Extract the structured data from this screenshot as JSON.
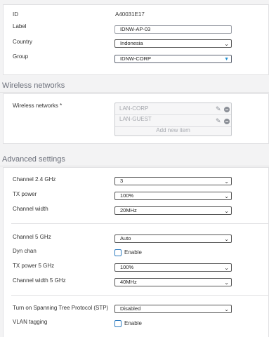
{
  "general": {
    "id_label": "ID",
    "id_value": "A40031E17",
    "label_label": "Label",
    "label_value": "IDNW-AP-03",
    "country_label": "Country",
    "country_value": "Indonesia",
    "group_label": "Group",
    "group_value": "IDNW-CORP"
  },
  "wireless": {
    "section_title": "Wireless networks",
    "field_label": "Wireless networks *",
    "networks": [
      "LAN-CORP",
      "LAN-GUEST"
    ],
    "add_new": "Add new item"
  },
  "advanced": {
    "section_title": "Advanced settings",
    "channel_24_label": "Channel 2.4 GHz",
    "channel_24_value": "3",
    "tx_power_label": "TX power",
    "tx_power_value": "100%",
    "channel_width_label": "Channel width",
    "channel_width_value": "20MHz",
    "channel_5_label": "Channel 5 GHz",
    "channel_5_value": "Auto",
    "dyn_chan_label": "Dyn chan",
    "dyn_chan_enable": "Enable",
    "tx_power_5_label": "TX power 5 GHz",
    "tx_power_5_value": "100%",
    "channel_width_5_label": "Channel width 5 GHz",
    "channel_width_5_value": "40MHz",
    "stp_label": "Turn on Spanning Tree Protocol (STP)",
    "stp_value": "Disabled",
    "vlan_label": "VLAN tagging",
    "vlan_enable": "Enable"
  },
  "icons": {
    "chevron": "chevron-down-icon",
    "edit": "pencil-icon",
    "remove": "minus-circle-icon"
  },
  "colors": {
    "accent": "#1f8fd1",
    "checkbox_border": "#2d7bbf",
    "section_title": "#6b6f7a"
  }
}
